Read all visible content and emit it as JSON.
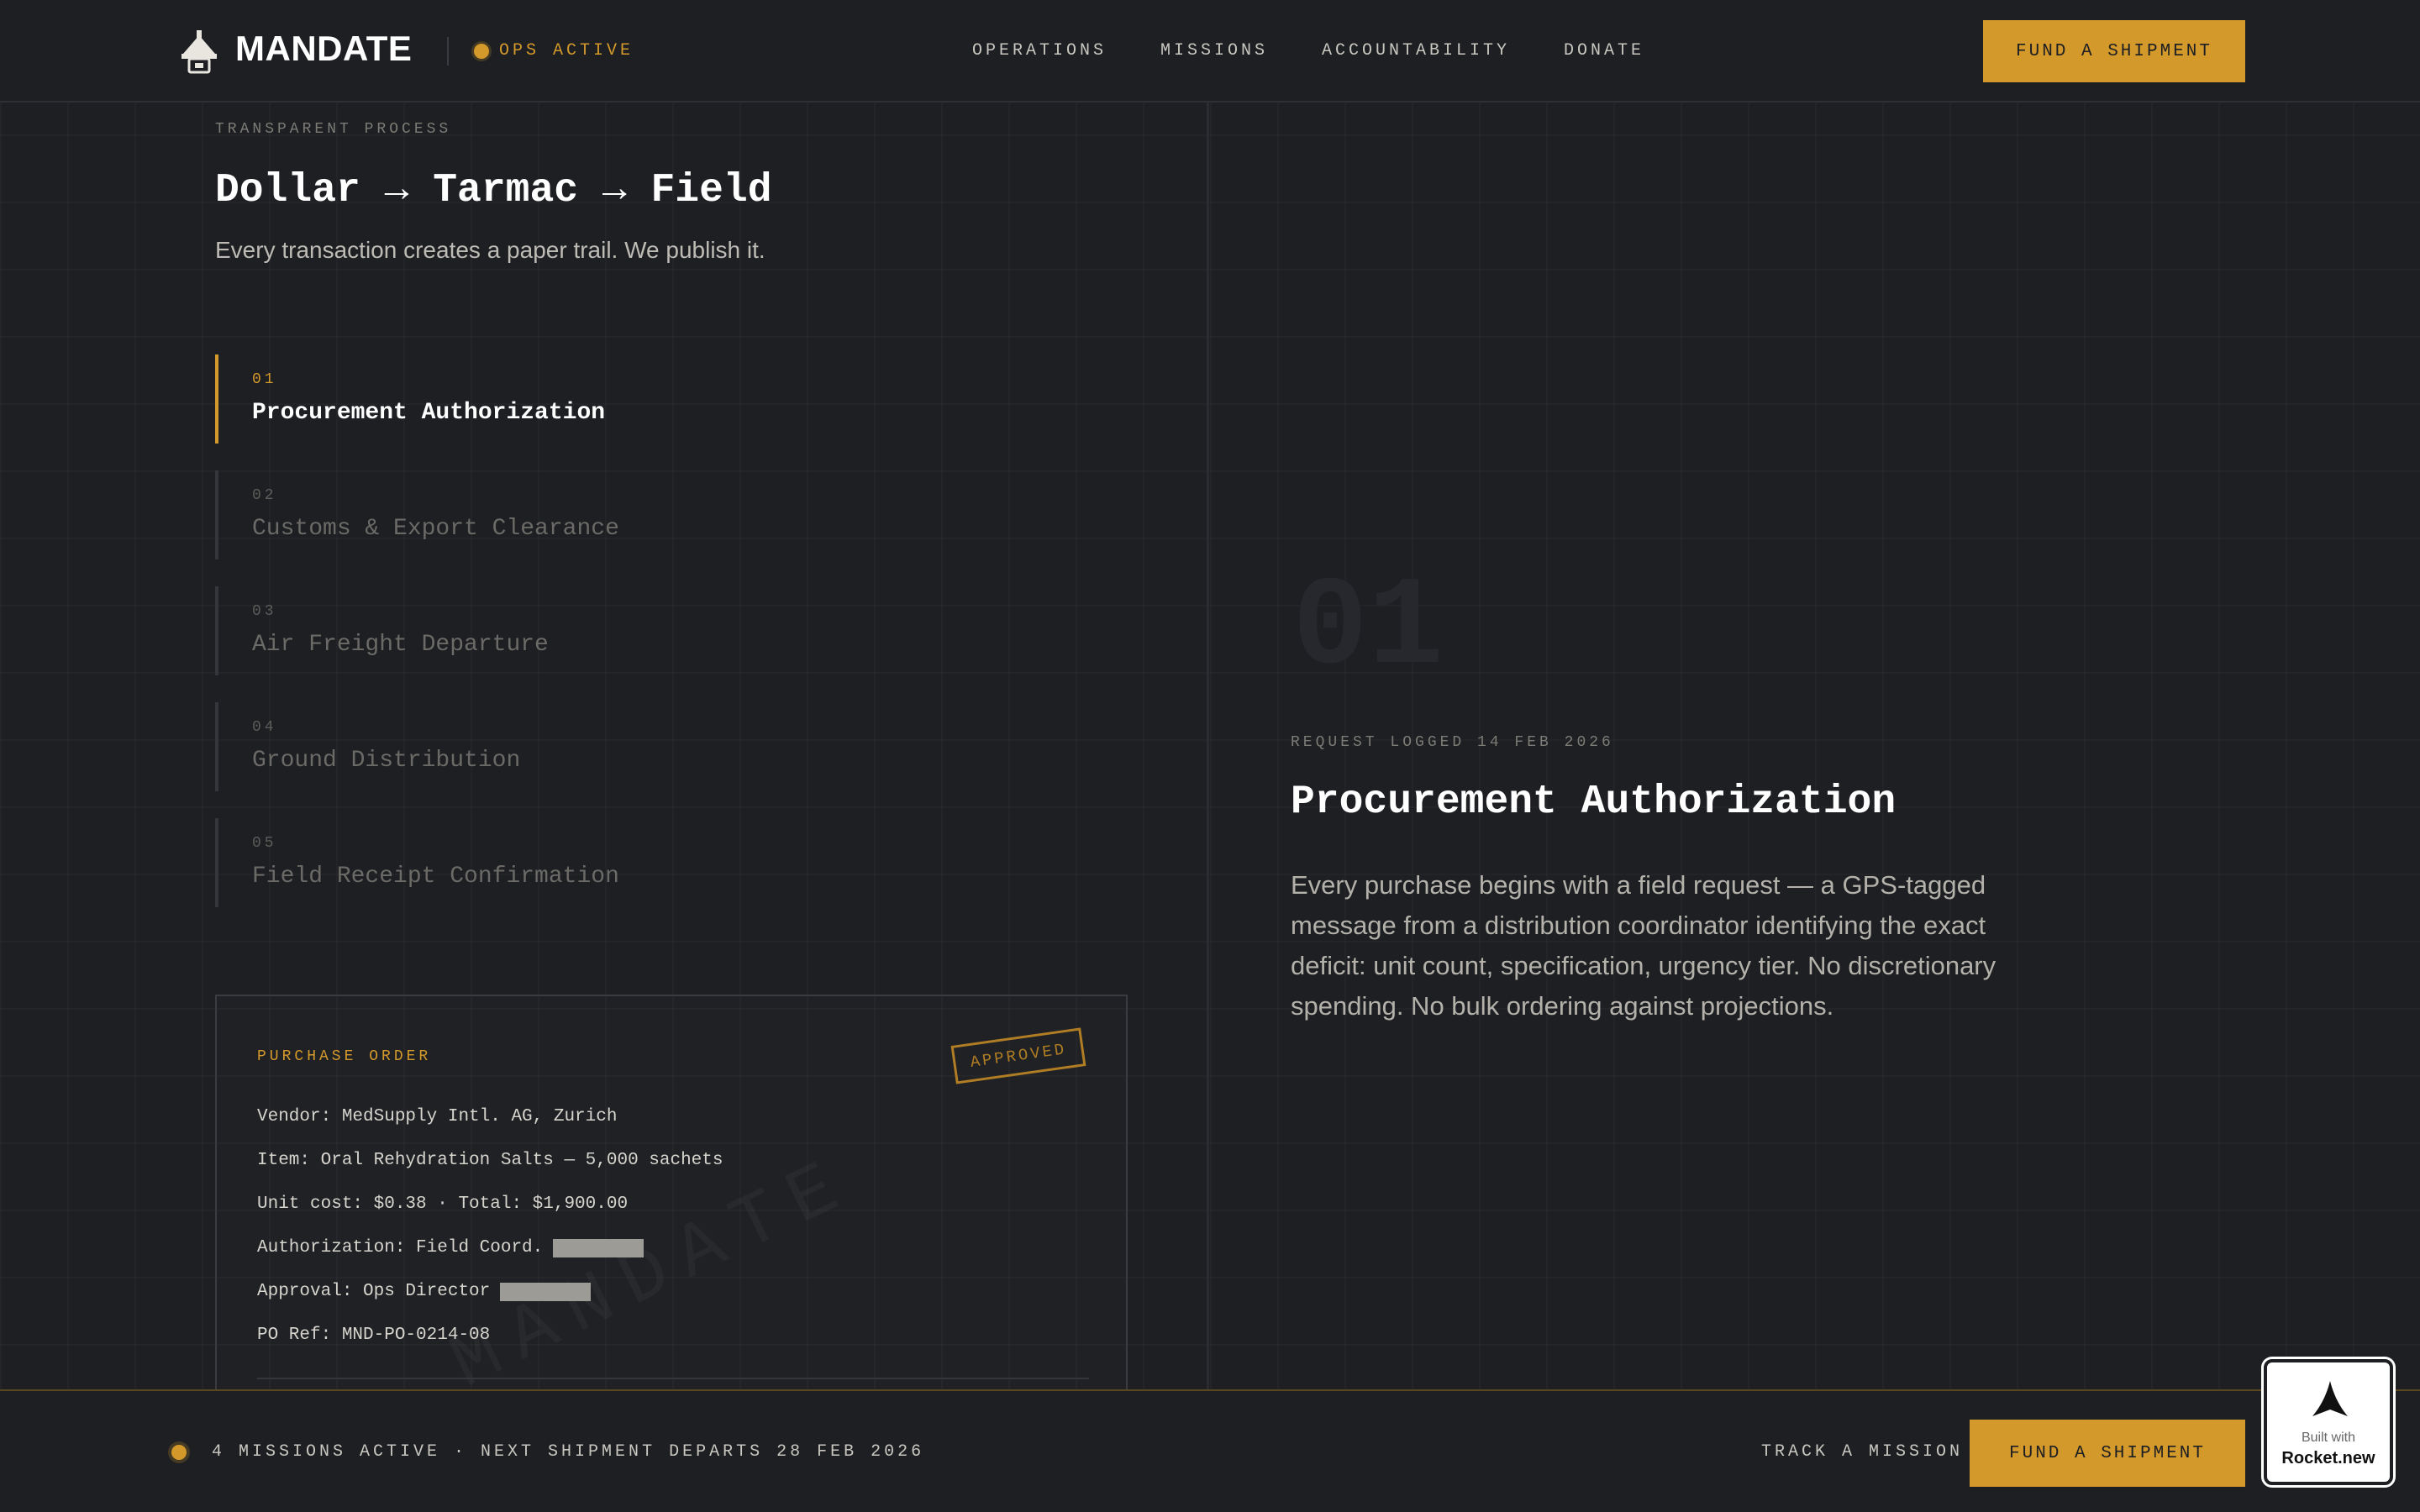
{
  "header": {
    "logo_text": "MANDATE",
    "status": "OPS ACTIVE",
    "nav": [
      "OPERATIONS",
      "MISSIONS",
      "ACCOUNTABILITY",
      "DONATE"
    ],
    "cta": "FUND A SHIPMENT"
  },
  "process": {
    "eyebrow": "TRANSPARENT PROCESS",
    "title": "Dollar → Tarmac → Field",
    "subtitle": "Every transaction creates a paper trail. We publish it.",
    "steps": [
      {
        "num": "01",
        "label": "Procurement Authorization",
        "active": true
      },
      {
        "num": "02",
        "label": "Customs & Export Clearance",
        "active": false
      },
      {
        "num": "03",
        "label": "Air Freight Departure",
        "active": false
      },
      {
        "num": "04",
        "label": "Ground Distribution",
        "active": false
      },
      {
        "num": "05",
        "label": "Field Receipt Confirmation",
        "active": false
      }
    ]
  },
  "purchase_order": {
    "heading": "PURCHASE ORDER",
    "stamp": "APPROVED",
    "watermark": "MANDATE",
    "vendor": "Vendor: MedSupply Intl. AG, Zurich",
    "item": "Item: Oral Rehydration Salts — 5,000 sachets",
    "cost": "Unit cost: $0.38 · Total: $1,900.00",
    "authorization": "Authorization: Field Coord.",
    "approval": "Approval: Ops Director",
    "ref": "PO Ref: MND-PO-0214-08"
  },
  "detail": {
    "big_number": "01",
    "meta": "REQUEST LOGGED 14 FEB 2026",
    "title": "Procurement Authorization",
    "body": "Every purchase begins with a field request — a GPS-tagged message from a distribution coordinator identifying the exact deficit: unit count, specification, urgency tier. No discretionary spending. No bulk ordering against projections."
  },
  "footer": {
    "status": "4 MISSIONS ACTIVE · NEXT SHIPMENT DEPARTS 28 FEB 2026",
    "track": "TRACK A MISSION",
    "cta": "FUND A SHIPMENT"
  },
  "badge": {
    "line1": "Built with",
    "line2": "Rocket.new"
  },
  "colors": {
    "accent": "#d4992b",
    "background": "#1d1f23"
  }
}
